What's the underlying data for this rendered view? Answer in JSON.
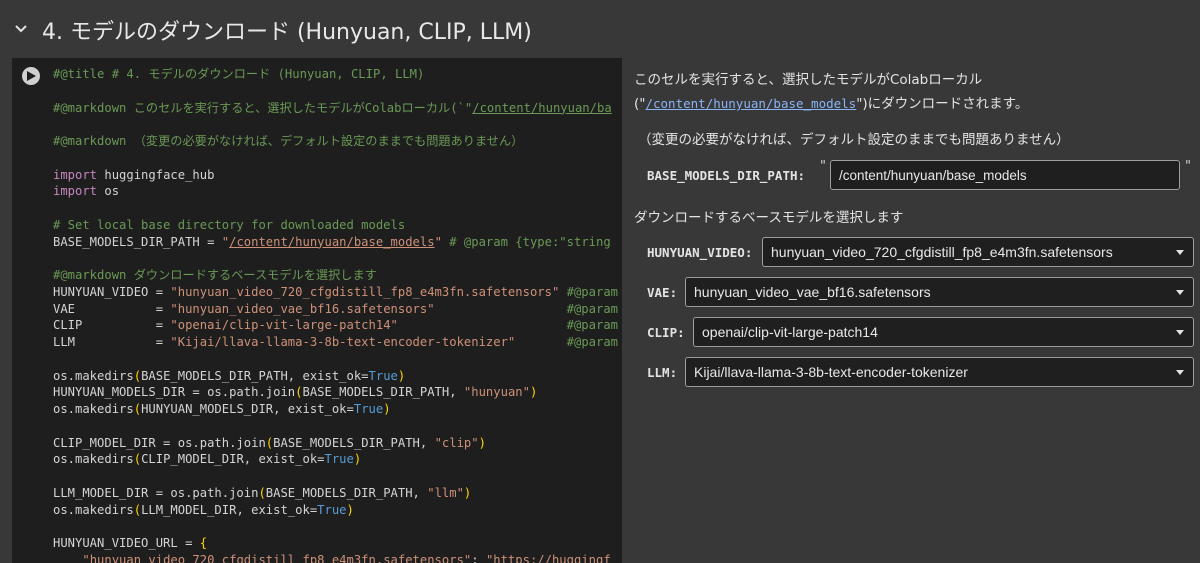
{
  "header": {
    "title": "4. モデルのダウンロード (Hunyuan, CLIP, LLM)"
  },
  "code": {
    "lines": [
      [
        {
          "t": "#@title # 4. モデルのダウンロード (Hunyuan, CLIP, LLM)",
          "c": "cm"
        }
      ],
      [],
      [
        {
          "t": "#@markdown このセルを実行すると、選択したモデルがColabローカル(`\"",
          "c": "cm"
        },
        {
          "t": "/content/hunyuan/ba",
          "c": "cm lnk"
        }
      ],
      [],
      [
        {
          "t": "#@markdown （変更の必要がなければ、デフォルト設定のままでも問題ありません）",
          "c": "cm"
        }
      ],
      [],
      [
        {
          "t": "import",
          "c": "kw"
        },
        {
          "t": " huggingface_hub"
        }
      ],
      [
        {
          "t": "import",
          "c": "kw"
        },
        {
          "t": " os"
        }
      ],
      [],
      [
        {
          "t": "# Set local base directory for downloaded models",
          "c": "cm"
        }
      ],
      [
        {
          "t": "BASE_MODELS_DIR_PATH = "
        },
        {
          "t": "\"",
          "c": "str"
        },
        {
          "t": "/content/hunyuan/base_models",
          "c": "str lnk"
        },
        {
          "t": "\"",
          "c": "str"
        },
        {
          "t": " # @param {type:\"string",
          "c": "cm"
        }
      ],
      [],
      [
        {
          "t": "#@markdown ダウンロードするベースモデルを選択します",
          "c": "cm"
        }
      ],
      [
        {
          "t": "HUNYUAN_VIDEO = "
        },
        {
          "t": "\"hunyuan_video_720_cfgdistill_fp8_e4m3fn.safetensors\"",
          "c": "str"
        },
        {
          "t": " #@param",
          "c": "cm"
        }
      ],
      [
        {
          "t": "VAE           = "
        },
        {
          "t": "\"hunyuan_video_vae_bf16.safetensors\"",
          "c": "str"
        },
        {
          "t": "                  #@param",
          "c": "cm"
        }
      ],
      [
        {
          "t": "CLIP          = "
        },
        {
          "t": "\"openai/clip-vit-large-patch14\"",
          "c": "str"
        },
        {
          "t": "                       #@param",
          "c": "cm"
        }
      ],
      [
        {
          "t": "LLM           = "
        },
        {
          "t": "\"Kijai/llava-llama-3-8b-text-encoder-tokenizer\"",
          "c": "str"
        },
        {
          "t": "       #@param",
          "c": "cm"
        }
      ],
      [],
      [
        {
          "t": "os.makedirs"
        },
        {
          "t": "(",
          "c": "paren"
        },
        {
          "t": "BASE_MODELS_DIR_PATH, exist_ok="
        },
        {
          "t": "True",
          "c": "bool"
        },
        {
          "t": ")",
          "c": "paren"
        }
      ],
      [
        {
          "t": "HUNYUAN_MODELS_DIR = os.path.join"
        },
        {
          "t": "(",
          "c": "paren"
        },
        {
          "t": "BASE_MODELS_DIR_PATH, "
        },
        {
          "t": "\"hunyuan\"",
          "c": "str"
        },
        {
          "t": ")",
          "c": "paren"
        }
      ],
      [
        {
          "t": "os.makedirs"
        },
        {
          "t": "(",
          "c": "paren"
        },
        {
          "t": "HUNYUAN_MODELS_DIR, exist_ok="
        },
        {
          "t": "True",
          "c": "bool"
        },
        {
          "t": ")",
          "c": "paren"
        }
      ],
      [],
      [
        {
          "t": "CLIP_MODEL_DIR = os.path.join"
        },
        {
          "t": "(",
          "c": "paren"
        },
        {
          "t": "BASE_MODELS_DIR_PATH, "
        },
        {
          "t": "\"clip\"",
          "c": "str"
        },
        {
          "t": ")",
          "c": "paren"
        }
      ],
      [
        {
          "t": "os.makedirs"
        },
        {
          "t": "(",
          "c": "paren"
        },
        {
          "t": "CLIP_MODEL_DIR, exist_ok="
        },
        {
          "t": "True",
          "c": "bool"
        },
        {
          "t": ")",
          "c": "paren"
        }
      ],
      [],
      [
        {
          "t": "LLM_MODEL_DIR = os.path.join"
        },
        {
          "t": "(",
          "c": "paren"
        },
        {
          "t": "BASE_MODELS_DIR_PATH, "
        },
        {
          "t": "\"llm\"",
          "c": "str"
        },
        {
          "t": ")",
          "c": "paren"
        }
      ],
      [
        {
          "t": "os.makedirs"
        },
        {
          "t": "(",
          "c": "paren"
        },
        {
          "t": "LLM_MODEL_DIR, exist_ok="
        },
        {
          "t": "True",
          "c": "bool"
        },
        {
          "t": ")",
          "c": "paren"
        }
      ],
      [],
      [
        {
          "t": "HUNYUAN_VIDEO_URL = "
        },
        {
          "t": "{",
          "c": "paren"
        }
      ],
      [
        {
          "t": "    "
        },
        {
          "t": "\"hunyuan_video_720_cfgdistill_fp8_e4m3fn.safetensors\"",
          "c": "str"
        },
        {
          "t": ": "
        },
        {
          "t": "\"https://huggingf",
          "c": "str"
        }
      ]
    ]
  },
  "form": {
    "desc_line1": "このセルを実行すると、選択したモデルがColabローカル",
    "desc_line2_open": "(\"",
    "desc_path": "/content/hunyuan/base_models",
    "desc_line2_close": "\")にダウンロードされます。",
    "desc_note": "（変更の必要がなければ、デフォルト設定のままでも問題ありません）",
    "base_dir_label": "BASE_MODELS_DIR_PATH:",
    "base_dir_value": "/content/hunyuan/base_models",
    "quote_open": "\"",
    "quote_close": "\"",
    "select_heading": "ダウンロードするベースモデルを選択します",
    "hunyuan_label": "HUNYUAN_VIDEO:",
    "hunyuan_value": "hunyuan_video_720_cfgdistill_fp8_e4m3fn.safetensors",
    "vae_label": "VAE:",
    "vae_value": "hunyuan_video_vae_bf16.safetensors",
    "clip_label": "CLIP:",
    "clip_value": "openai/clip-vit-large-patch14",
    "llm_label": "LLM:",
    "llm_value": "Kijai/llava-llama-3-8b-text-encoder-tokenizer"
  },
  "icons": {
    "collapse": "chevron-down-icon",
    "run": "play-icon"
  }
}
